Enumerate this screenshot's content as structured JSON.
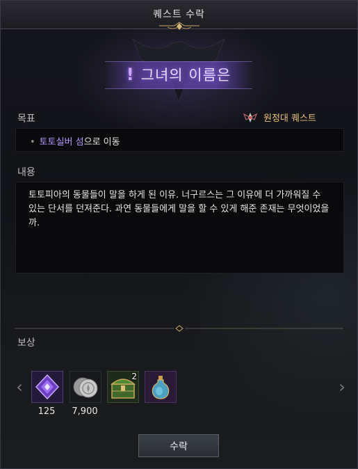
{
  "window": {
    "title": "퀘스트 수락"
  },
  "banner": {
    "quest_name": "그녀의 이름은",
    "exclamation": "!"
  },
  "objective": {
    "label": "목표",
    "bullet": "•",
    "highlight_text": "토토실버 섬",
    "rest_text": "으로 이동"
  },
  "quest_type": {
    "label": "원정대 퀘스트",
    "icon": "expedition-emblem-icon"
  },
  "content": {
    "label": "내용",
    "text": "토토피아의 동물들이 말을 하게 된 이유. 너구르스는 그 이유에 더 가까워질 수 있는 단서를 던져준다. 과연 동물들에게 말을 할 수 있게 해준 존재는 무엇이었을까."
  },
  "rewards": {
    "label": "보상",
    "prev_arrow": "‹",
    "next_arrow": "›",
    "items": [
      {
        "icon": "purple-crystal-icon",
        "count": "125"
      },
      {
        "icon": "silver-coin-icon",
        "count": "7,900"
      },
      {
        "icon": "green-chest-icon",
        "stack": "2"
      },
      {
        "icon": "blue-potion-icon"
      }
    ]
  },
  "actions": {
    "accept_label": "수락"
  },
  "colors": {
    "accent_purple": "#b397ff",
    "quest_type_gold": "#e6c27a",
    "panel_bg": "#121318"
  }
}
